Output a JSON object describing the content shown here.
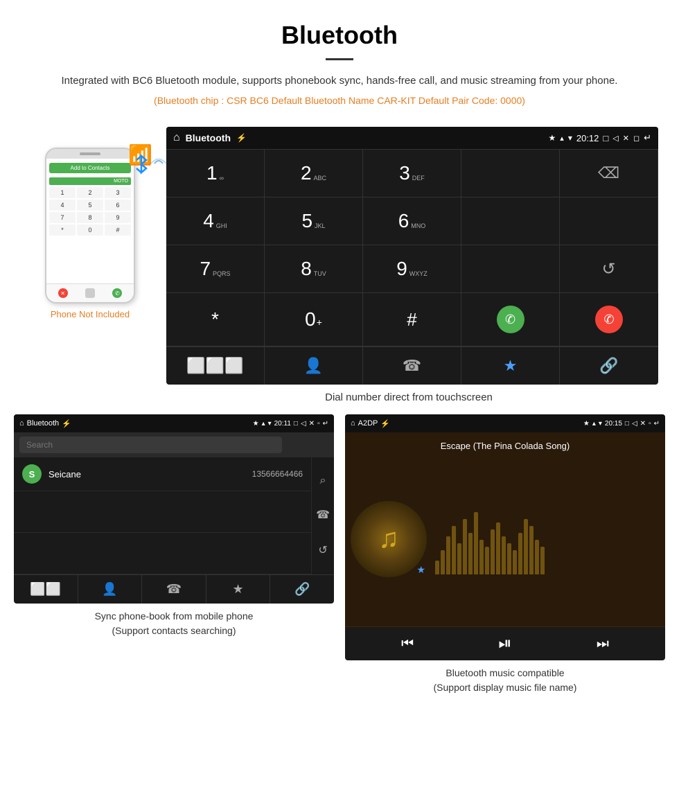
{
  "page": {
    "title": "Bluetooth",
    "divider": true,
    "description": "Integrated with BC6 Bluetooth module, supports phonebook sync, hands-free call, and music streaming from your phone.",
    "specs": "(Bluetooth chip : CSR BC6    Default Bluetooth Name CAR-KIT    Default Pair Code: 0000)"
  },
  "dial_screen": {
    "status_bar": {
      "app_name": "Bluetooth",
      "time": "20:12"
    },
    "keys": [
      {
        "number": "1",
        "letters": "∞"
      },
      {
        "number": "2",
        "letters": "ABC"
      },
      {
        "number": "3",
        "letters": "DEF"
      },
      {
        "number": "",
        "letters": ""
      },
      {
        "action": "backspace"
      },
      {
        "number": "4",
        "letters": "GHI"
      },
      {
        "number": "5",
        "letters": "JKL"
      },
      {
        "number": "6",
        "letters": "MNO"
      },
      {
        "number": "",
        "letters": ""
      },
      {
        "number": "",
        "letters": ""
      },
      {
        "number": "7",
        "letters": "PQRS"
      },
      {
        "number": "8",
        "letters": "TUV"
      },
      {
        "number": "9",
        "letters": "WXYZ"
      },
      {
        "number": "",
        "letters": ""
      },
      {
        "action": "refresh"
      },
      {
        "action": "star"
      },
      {
        "number": "0",
        "letters": "+",
        "super": true
      },
      {
        "action": "hash"
      },
      {
        "action": "call_green"
      },
      {
        "action": "call_red"
      }
    ],
    "nav": [
      "grid",
      "person",
      "phone",
      "bluetooth",
      "link"
    ]
  },
  "dial_caption": "Dial number direct from touchscreen",
  "phone": {
    "not_included": "Phone Not Included"
  },
  "phonebook_screen": {
    "status_bar": {
      "app_name": "Bluetooth",
      "time": "20:11"
    },
    "search_placeholder": "Search",
    "contacts": [
      {
        "initial": "S",
        "name": "Seicane",
        "number": "13566664466"
      }
    ],
    "caption": "Sync phone-book from mobile phone\n(Support contacts searching)"
  },
  "music_screen": {
    "status_bar": {
      "app_name": "A2DP",
      "time": "20:15"
    },
    "song_name": "Escape (The Pina Colada Song)",
    "eq_bars": [
      20,
      35,
      55,
      70,
      45,
      80,
      60,
      90,
      50,
      40,
      65,
      75,
      55,
      45,
      35,
      60,
      80,
      70,
      50,
      40
    ],
    "caption": "Bluetooth music compatible\n(Support display music file name)"
  }
}
